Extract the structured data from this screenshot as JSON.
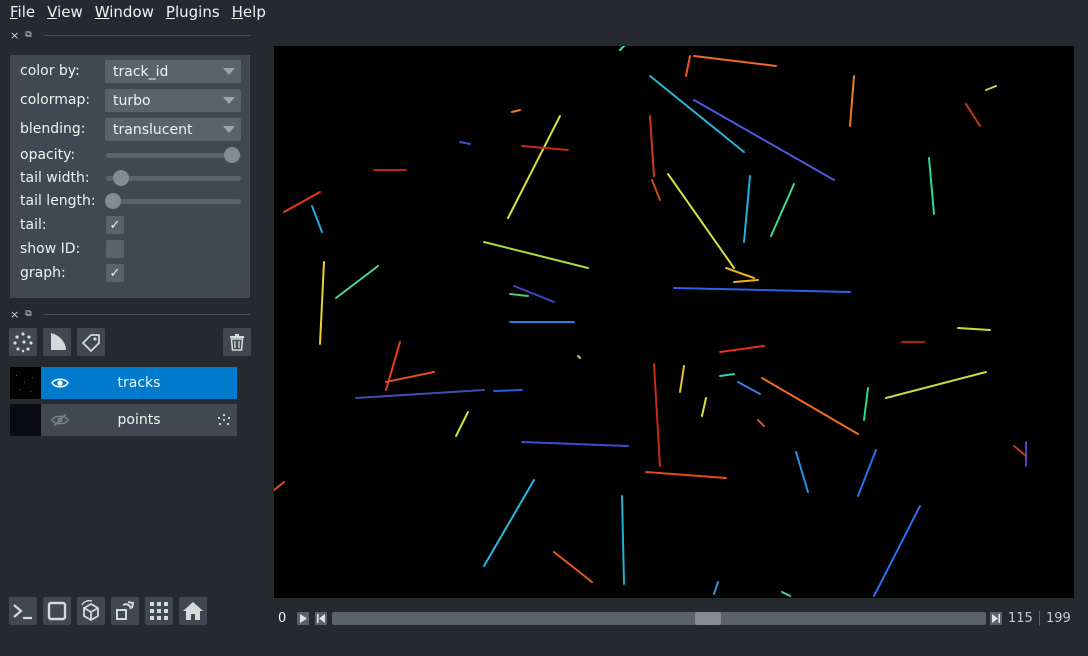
{
  "menu": {
    "items": [
      {
        "key": "F",
        "rest": "ile"
      },
      {
        "key": "V",
        "rest": "iew"
      },
      {
        "key": "W",
        "rest": "indow"
      },
      {
        "key": "P",
        "rest": "lugins"
      },
      {
        "key": "H",
        "rest": "elp"
      }
    ]
  },
  "dock": {
    "close_glyph": "×",
    "float_glyph": "⧉"
  },
  "layer_controls": {
    "color_by": {
      "label": "color by:",
      "value": "track_id"
    },
    "colormap": {
      "label": "colormap:",
      "value": "turbo"
    },
    "blending": {
      "label": "blending:",
      "value": "translucent"
    },
    "opacity": {
      "label": "opacity:",
      "value": 1.0
    },
    "tail_width": {
      "label": "tail width:",
      "value": 0.07
    },
    "tail_length": {
      "label": "tail length:",
      "value": 0.0
    },
    "tail": {
      "label": "tail:",
      "checked": true
    },
    "show_id": {
      "label": "show ID:",
      "checked": false
    },
    "graph": {
      "label": "graph:",
      "checked": true
    },
    "check_glyph": "✓"
  },
  "layer_list": [
    {
      "name": "tracks",
      "visible": true,
      "selected": true
    },
    {
      "name": "points",
      "visible": false,
      "selected": false
    }
  ],
  "dims_slider": {
    "start": "0",
    "current": "115",
    "max": "199",
    "position": 0.578
  },
  "colors": {
    "background": "#262930",
    "panel": "#414851",
    "selected_layer": "#007acc",
    "unselected_layer": "#414851",
    "canvas": "#000000"
  },
  "icons": {
    "buttons_top": [
      "points-layer-icon",
      "shapes-layer-icon",
      "labels-layer-icon",
      "delete-layer-icon"
    ],
    "buttons_bottom": [
      "console-icon",
      "ndisplay-icon",
      "roll-icon",
      "transpose-icon",
      "grid-icon",
      "home-icon"
    ]
  }
}
